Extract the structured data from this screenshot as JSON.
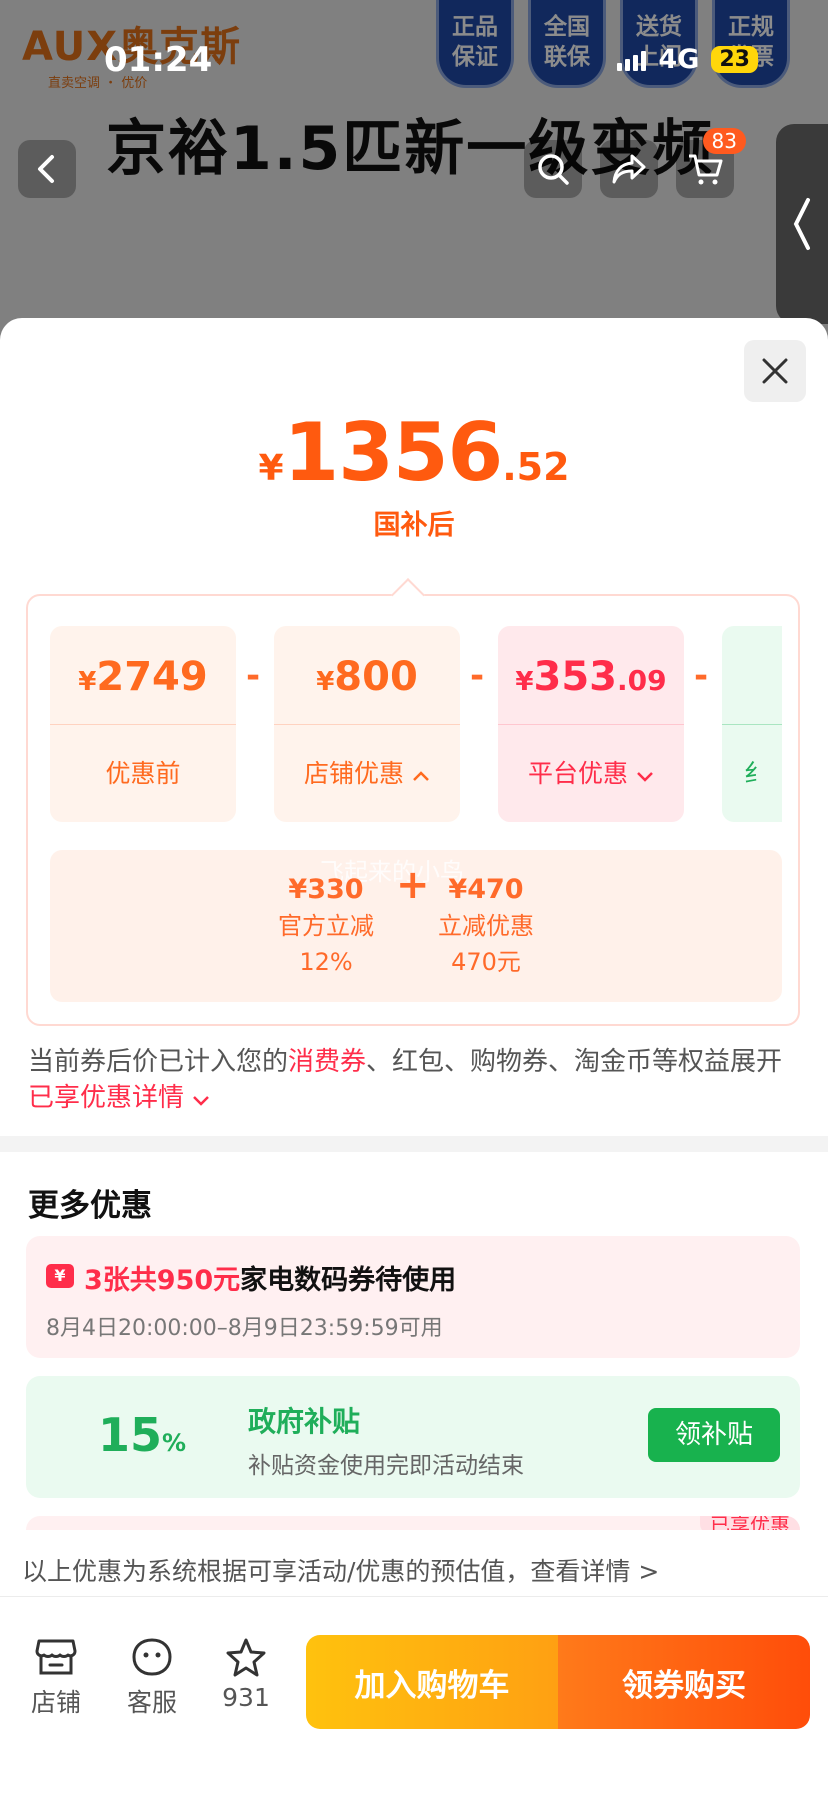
{
  "status_bar": {
    "time": "01:24",
    "network": "4G",
    "battery": "23"
  },
  "background": {
    "brand_logo": "AUX奥克斯",
    "brand_subtitle": "直卖空调 ・ 优价",
    "badges": [
      {
        "line1": "正品",
        "line2": "保证"
      },
      {
        "line1": "全国",
        "line2": "联保"
      },
      {
        "line1": "送货",
        "line2": "上门"
      },
      {
        "line1": "正规",
        "line2": "发票"
      }
    ],
    "product_title": "京裕1.5匹新一级变频",
    "cart_count": "83"
  },
  "sheet": {
    "final_price": {
      "symbol": "¥",
      "integer": "1356",
      "decimal": ".52",
      "note": "国补后"
    },
    "breakdown": [
      {
        "symbol": "¥",
        "amount": "2749",
        "decimal": "",
        "label": "优惠前",
        "color": "#ff6a1f",
        "bg": "#fff3ec",
        "line": "#ffd2c0"
      },
      {
        "symbol": "¥",
        "amount": "800",
        "decimal": "",
        "label": "店铺优惠",
        "chevron": "up",
        "color": "#ff6a1f",
        "bg": "#fff3ec",
        "line": "#ffd2c0"
      },
      {
        "symbol": "¥",
        "amount": "353",
        "decimal": ".09",
        "label": "平台优惠",
        "chevron": "down",
        "color": "#ff2d4a",
        "bg": "#ffe9ec",
        "line": "#ffc6cf"
      },
      {
        "symbol": "¥",
        "amount": "",
        "decimal": "",
        "label": "纟",
        "color": "#1fae5a",
        "bg": "#eafaf0",
        "line": "#a9e5c1"
      }
    ],
    "store_discount_detail": [
      {
        "value": "¥330",
        "name": "官方立减",
        "extra": "12%"
      },
      {
        "value": "¥470",
        "name": "立减优惠",
        "extra": "470元"
      }
    ],
    "watermark": "飞起来的小鸟",
    "notice": {
      "prefix": "当前券后价已计入您的",
      "highlight1": "消费券",
      "middle": "、红包、购物券、淘金币等权益展开",
      "highlight2": "已享优惠详情"
    },
    "more_title": "更多优惠",
    "coupon": {
      "icon": "¥",
      "highlight": "3张共950元",
      "text": "家电数码券待使用",
      "time": "8月4日20:00:00–8月9日23:59:59可用"
    },
    "subsidy": {
      "percent": "15",
      "percent_sign": "%",
      "title": "政府补贴",
      "desc": "补贴资金使用完即活动结束",
      "button": "领补贴"
    },
    "peek_tag": "已享优惠",
    "disclaimer": "以上优惠为系统根据可享活动/优惠的预估值，查看详情 >"
  },
  "bottom_bar": {
    "store": "店铺",
    "service": "客服",
    "favorite_count": "931",
    "add_cart": "加入购物车",
    "buy": "领券购买"
  }
}
